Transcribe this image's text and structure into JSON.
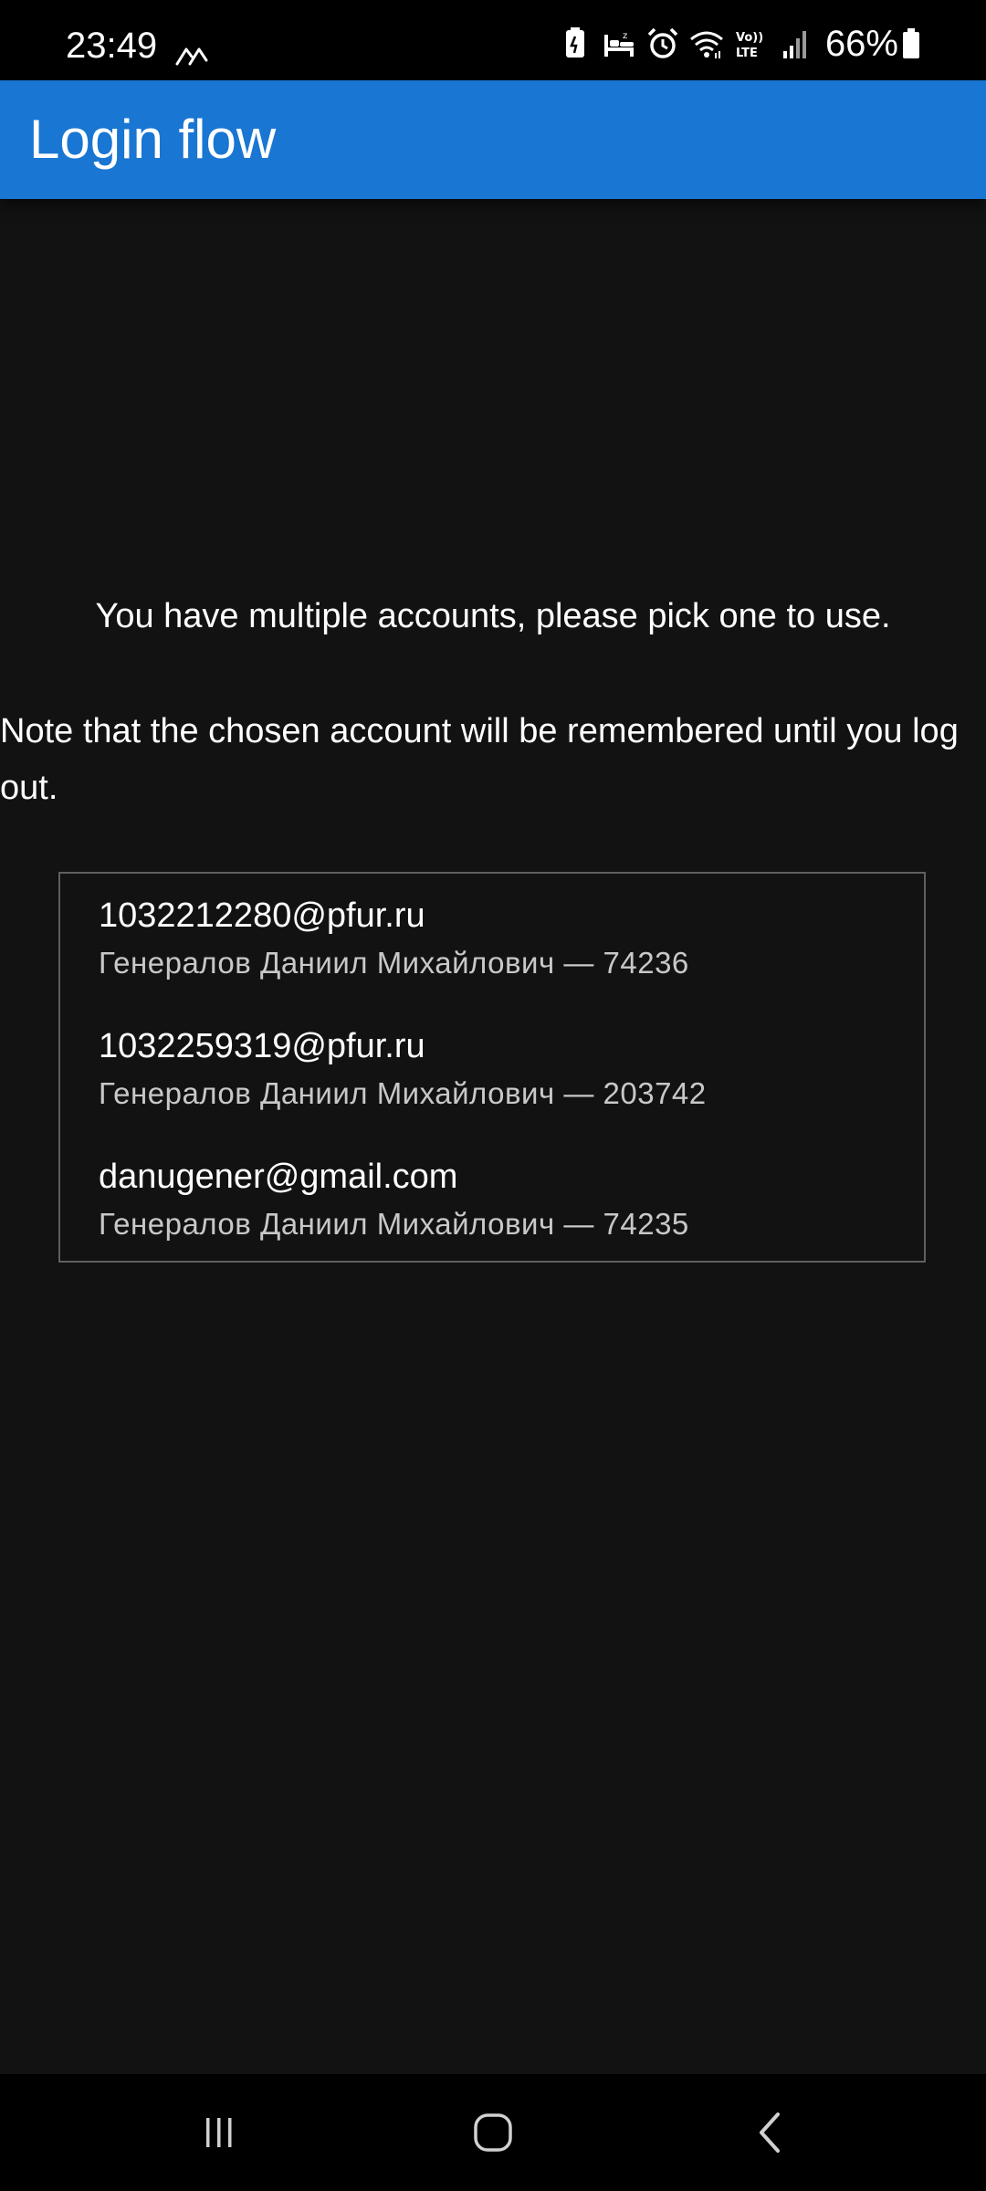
{
  "status_bar": {
    "time": "23:49",
    "battery_percent": "66%",
    "icons": [
      "signal-arc-icon",
      "battery-saver-icon",
      "sleep-mode-icon",
      "alarm-icon",
      "wifi-icon",
      "volte-icon",
      "cell-signal-icon",
      "battery-icon"
    ],
    "volte_label_top": "Vo))",
    "volte_label_bottom": "LTE"
  },
  "app_bar": {
    "title": "Login flow",
    "color": "#1976d2"
  },
  "main": {
    "prompt": "You have multiple accounts, please pick one to use.",
    "note": "Note that the chosen account will be remembered until you log out.",
    "accounts": [
      {
        "email": "1032212280@pfur.ru",
        "detail": "Генералов Даниил Михайлович — 74236"
      },
      {
        "email": "1032259319@pfur.ru",
        "detail": "Генералов Даниил Михайлович — 203742"
      },
      {
        "email": "danugener@gmail.com",
        "detail": "Генералов Даниил Михайлович — 74235"
      }
    ]
  },
  "nav_bar": {
    "icons": [
      "recent-apps-icon",
      "home-icon",
      "back-icon"
    ]
  }
}
